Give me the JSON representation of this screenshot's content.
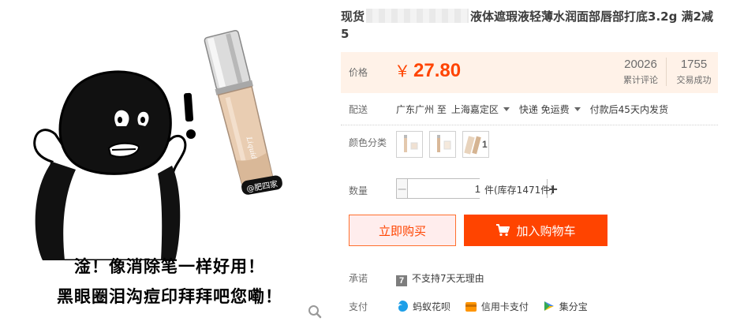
{
  "product": {
    "title_prefix": "现货",
    "title_rest": "液体遮瑕液轻薄水润面部唇部打底3.2g 满2减5",
    "image_watermark": "@肥四家",
    "image_caption_line1": "淦！像消除笔一样好用！",
    "image_caption_line2": "黑眼圈泪沟痘印拜拜吧您嘞！",
    "zoom_icon": "magnifier-icon"
  },
  "price": {
    "label": "价格",
    "currency": "￥",
    "value": "27.80",
    "reviews_count": "20026",
    "reviews_label": "累计评论",
    "deals_count": "1755",
    "deals_label": "交易成功"
  },
  "shipping": {
    "label": "配送",
    "from": "广东广州 至",
    "to": "上海嘉定区",
    "method": "快递 免运费",
    "dispatch": "付款后45天内发货"
  },
  "color": {
    "label": "颜色分类",
    "options": [
      "swatch-1",
      "swatch-2",
      "swatch-3"
    ]
  },
  "quantity": {
    "label": "数量",
    "value": "1",
    "minus": "−",
    "plus": "+",
    "stock_text": "件(库存1471件)"
  },
  "actions": {
    "buy_now": "立即购买",
    "add_to_cart": "加入购物车"
  },
  "promise": {
    "label": "承诺",
    "badge": "7",
    "text": "不支持7天无理由"
  },
  "payment": {
    "label": "支付",
    "methods": [
      "蚂蚁花呗",
      "信用卡支付",
      "集分宝"
    ]
  },
  "colors": {
    "accent": "#ff4400",
    "price_bg": "#fff2e8",
    "buy_now_bg": "#ffeded"
  }
}
